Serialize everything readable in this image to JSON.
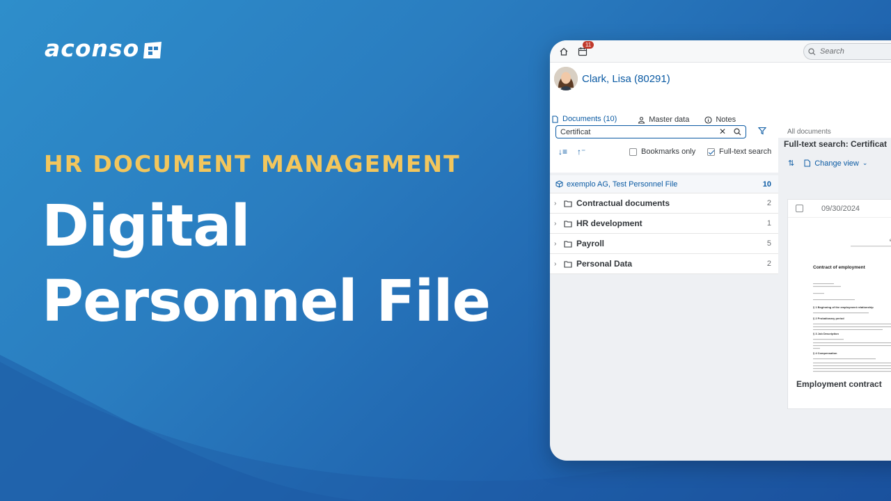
{
  "brand": {
    "logo_text": "aconso"
  },
  "hero": {
    "eyebrow": "HR DOCUMENT MANAGEMENT",
    "line1": "Digital",
    "line2": "Personnel File"
  },
  "shell": {
    "notification_count": "11",
    "search_placeholder": "Search"
  },
  "employee": {
    "name": "Clark, Lisa (80291)"
  },
  "tabs": [
    {
      "label": "Documents (10)",
      "icon": "document-icon"
    },
    {
      "label": "Master data",
      "icon": "person-icon"
    },
    {
      "label": "Notes",
      "icon": "info-icon"
    }
  ],
  "filter": {
    "query": "Certificat",
    "bookmarks_label": "Bookmarks only",
    "fulltext_label": "Full-text search",
    "bookmarks_checked": false,
    "fulltext_checked": true
  },
  "tree": {
    "root": {
      "label": "exemplo AG, Test Personnel File",
      "count": "10"
    },
    "folders": [
      {
        "label": "Contractual documents",
        "count": "2"
      },
      {
        "label": "HR development",
        "count": "1"
      },
      {
        "label": "Payroll",
        "count": "5"
      },
      {
        "label": "Personal Data",
        "count": "2"
      }
    ]
  },
  "results": {
    "breadcrumb": "All documents",
    "title": "Full-text search: Certificat",
    "change_view_label": "Change view",
    "card": {
      "date": "09/30/2024",
      "document_title": "Employment contract",
      "preview_heading": "Contract of employment",
      "preview_brand": "exemplo",
      "sections": [
        "§ 1 Beginning of the employment relationship",
        "§ 2 Probationary period",
        "§ 3 Job Description",
        "§ 4 Compensation"
      ]
    }
  },
  "colors": {
    "accent": "#0a5aa3",
    "eyebrow": "#f2c65d",
    "badge": "#c0392b"
  }
}
